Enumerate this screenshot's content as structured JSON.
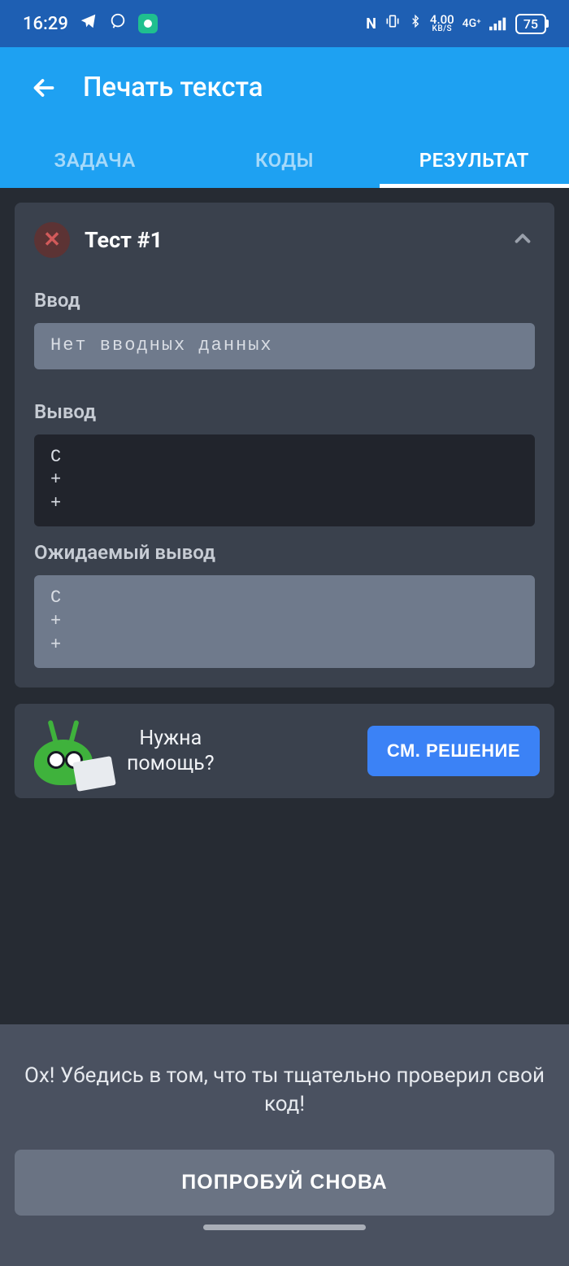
{
  "status": {
    "time": "16:29",
    "net_speed": "4.00",
    "net_unit": "KB/S",
    "net_gen": "4G⁺",
    "battery": "75"
  },
  "header": {
    "title": "Печать текста"
  },
  "tabs": {
    "task": "ЗАДАЧА",
    "codes": "КОДЫ",
    "result": "РЕЗУЛЬТАТ"
  },
  "test": {
    "title": "Тест #1",
    "input_label": "Ввод",
    "input_value": "Нет вводных данных",
    "output_label": "Вывод",
    "output_value": "C\n+\n+",
    "expected_label": "Ожидаемый вывод",
    "expected_value": "C\n+\n+"
  },
  "help": {
    "text": "Нужна\nпомощь?",
    "button": "СМ. РЕШЕНИЕ"
  },
  "bottom": {
    "message": "Ох! Убедись в том, что ты тщательно проверил свой код!",
    "retry": "ПОПРОБУЙ СНОВА"
  }
}
